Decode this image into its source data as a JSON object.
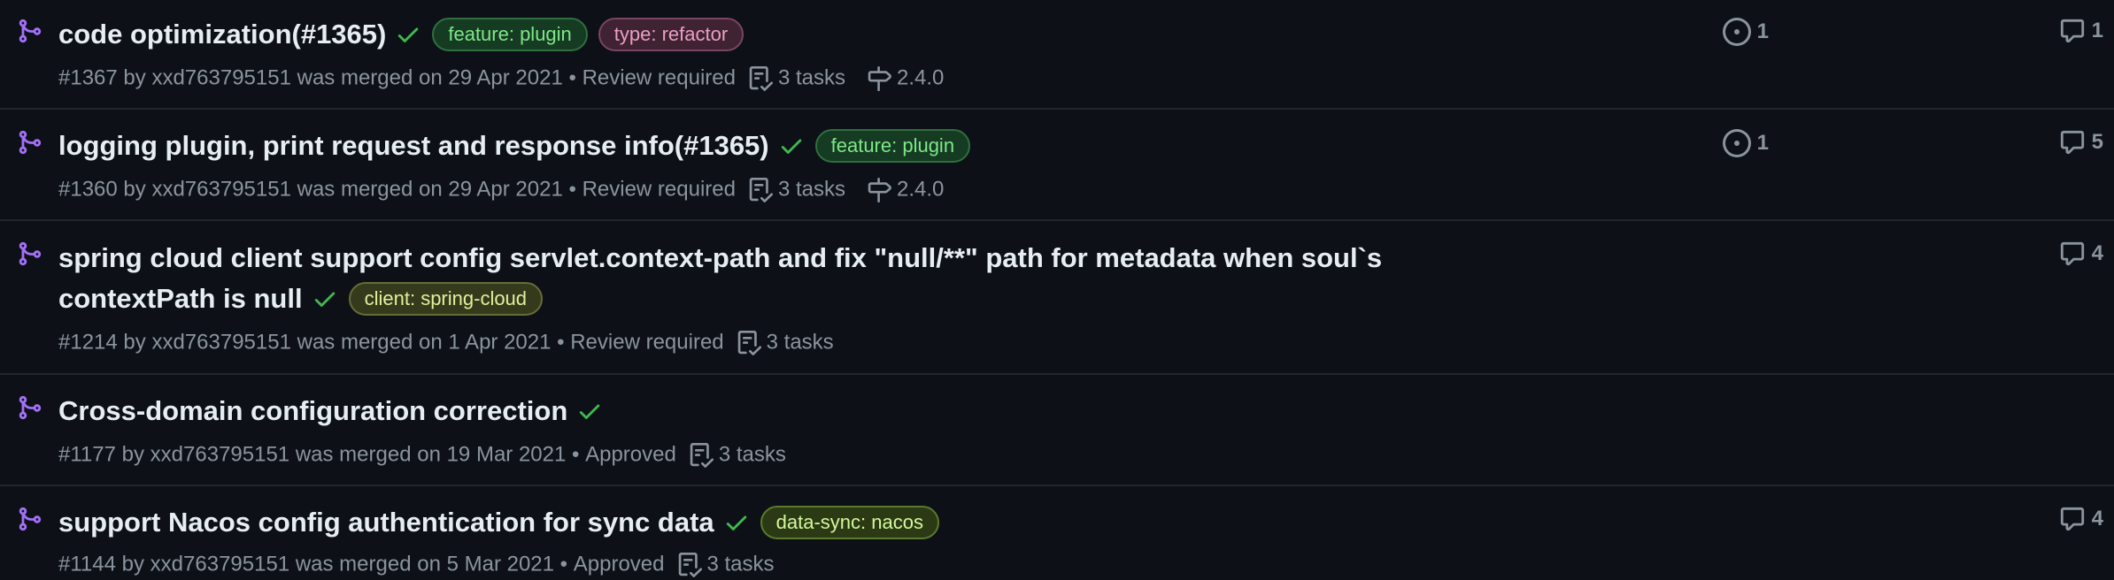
{
  "colors": {
    "background": "#0d1117",
    "merged_icon": "#a371f7",
    "check": "#3fb950",
    "muted": "#8b949e"
  },
  "icons": {
    "merged": "git-merge-icon",
    "check": "check-icon",
    "tasks": "tasklist-icon",
    "milestone": "milestone-icon",
    "linked_issue": "issue-opened-icon",
    "comments": "comment-icon"
  },
  "pull_requests": [
    {
      "title": "code optimization(#1365)",
      "labels": [
        {
          "text": "feature: plugin",
          "bg": "#163b23",
          "fg": "#7ee787",
          "border": "#2f6f3e"
        },
        {
          "text": "type: refactor",
          "bg": "#3f2332",
          "fg": "#ec9ec4",
          "border": "#7a4562"
        }
      ],
      "number": "#1367",
      "by_text": "by",
      "author": "xxd763795151",
      "merged_text": "was merged on 29 Apr 2021",
      "separator": "•",
      "review": "Review required",
      "tasks": "3 tasks",
      "milestone": "2.4.0",
      "linked_issues": "1",
      "comments": "1"
    },
    {
      "title": "logging plugin, print request and response info(#1365)",
      "labels": [
        {
          "text": "feature: plugin",
          "bg": "#163b23",
          "fg": "#7ee787",
          "border": "#2f6f3e"
        }
      ],
      "number": "#1360",
      "by_text": "by",
      "author": "xxd763795151",
      "merged_text": "was merged on 29 Apr 2021",
      "separator": "•",
      "review": "Review required",
      "tasks": "3 tasks",
      "milestone": "2.4.0",
      "linked_issues": "1",
      "comments": "5"
    },
    {
      "title_line1": "spring cloud client support config servlet.context-path and fix \"null/**\" path for metadata when soul`s",
      "title_line2": "contextPath is null",
      "labels": [
        {
          "text": "client: spring-cloud",
          "bg": "#353a1c",
          "fg": "#e3ef9b",
          "border": "#656d37"
        }
      ],
      "number": "#1214",
      "by_text": "by",
      "author": "xxd763795151",
      "merged_text": "was merged on 1 Apr 2021",
      "separator": "•",
      "review": "Review required",
      "tasks": "3 tasks",
      "comments": "4"
    },
    {
      "title": "Cross-domain configuration correction",
      "labels": [],
      "number": "#1177",
      "by_text": "by",
      "author": "xxd763795151",
      "merged_text": "was merged on 19 Mar 2021",
      "separator": "•",
      "review": "Approved",
      "tasks": "3 tasks"
    },
    {
      "title": "support Nacos config authentication for sync data",
      "labels": [
        {
          "text": "data-sync: nacos",
          "bg": "#2b3a14",
          "fg": "#d4f79b",
          "border": "#5b7a2c"
        }
      ],
      "number": "#1144",
      "by_text": "by",
      "author": "xxd763795151",
      "merged_text": "was merged on 5 Mar 2021",
      "separator": "•",
      "review": "Approved",
      "tasks": "3 tasks",
      "comments": "4"
    }
  ]
}
